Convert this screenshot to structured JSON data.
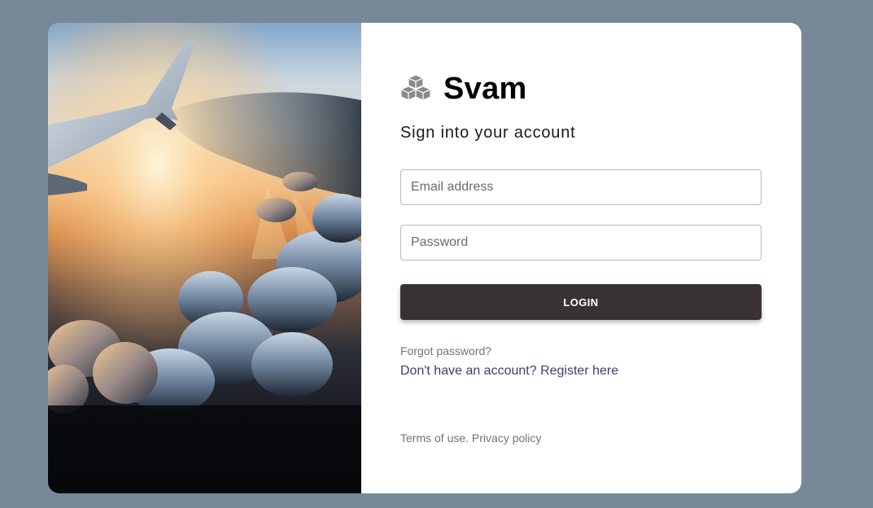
{
  "brand": {
    "name": "Svam",
    "icon": "cubes-icon",
    "icon_color": "#8a8a8a"
  },
  "form": {
    "subtitle": "Sign into your account",
    "email_placeholder": "Email address",
    "password_placeholder": "Password",
    "login_label": "LOGIN",
    "forgot_label": "Forgot password?",
    "register_prompt": "Don't have an account?",
    "register_link": "Register here"
  },
  "footer": {
    "terms_label": "Terms of use.",
    "privacy_label": "Privacy policy"
  },
  "colors": {
    "page_background": "#778899",
    "button_background": "#393233",
    "link_color": "#3b3f70",
    "muted_text": "#6c757d"
  }
}
